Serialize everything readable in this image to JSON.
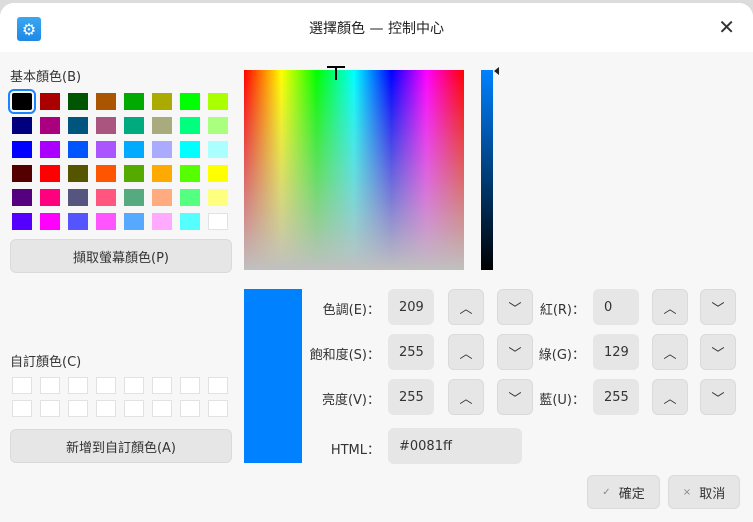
{
  "window": {
    "title": "選擇顏色 — 控制中心",
    "close": "✕",
    "app_icon": "⚙"
  },
  "basic_label": "基本顏色(B)",
  "basic_colors": [
    [
      "#000000",
      "#aa0000",
      "#005500",
      "#aa5500",
      "#00aa00",
      "#aaaa00",
      "#00ff00",
      "#aaff00"
    ],
    [
      "#00007f",
      "#aa007f",
      "#00557f",
      "#aa557f",
      "#00aa7f",
      "#aaaa7f",
      "#00ff7f",
      "#aaff7f"
    ],
    [
      "#0000ff",
      "#aa00ff",
      "#0055ff",
      "#aa55ff",
      "#00aaff",
      "#aaaaff",
      "#00ffff",
      "#aaffff"
    ],
    [
      "#550000",
      "#ff0000",
      "#555500",
      "#ff5500",
      "#55aa00",
      "#ffaa00",
      "#55ff00",
      "#ffff00"
    ],
    [
      "#55007f",
      "#ff007f",
      "#55557f",
      "#ff557f",
      "#55aa7f",
      "#ffaa7f",
      "#55ff7f",
      "#ffff7f"
    ],
    [
      "#5500ff",
      "#ff00ff",
      "#5555ff",
      "#ff55ff",
      "#55aaff",
      "#ffaaff",
      "#55ffff",
      "#ffffff"
    ]
  ],
  "pick_screen": "擷取螢幕顏色(P)",
  "custom_label": "自訂顏色(C)",
  "add_custom": "新增到自訂顏色(A)",
  "current_color": "#0081ff",
  "fields": {
    "hue": {
      "label": "色調(E)：",
      "value": "209"
    },
    "sat": {
      "label": "飽和度(S)：",
      "value": "255"
    },
    "val": {
      "label": "亮度(V)：",
      "value": "255"
    },
    "red": {
      "label": "紅(R)：",
      "value": "0"
    },
    "green": {
      "label": "綠(G)：",
      "value": "129"
    },
    "blue": {
      "label": "藍(U)：",
      "value": "255"
    },
    "html": {
      "label": "HTML：",
      "value": "#0081ff"
    }
  },
  "spin_up": "︿",
  "spin_down": "﹀",
  "ok": {
    "icon": "✓",
    "label": "確定"
  },
  "cancel": {
    "icon": "×",
    "label": "取消"
  }
}
